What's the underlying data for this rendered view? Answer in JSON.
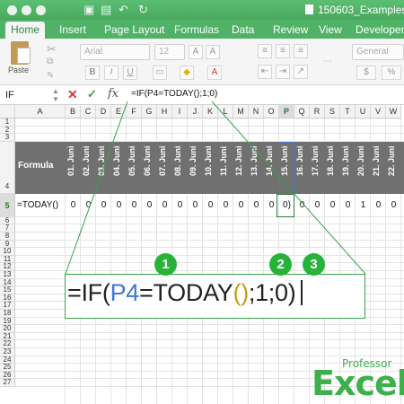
{
  "title_bar": {
    "doc_title": "150603_Examples"
  },
  "tabs": [
    {
      "label": "Home",
      "active": true
    },
    {
      "label": "Insert"
    },
    {
      "label": "Page Layout"
    },
    {
      "label": "Formulas"
    },
    {
      "label": "Data"
    },
    {
      "label": "Review"
    },
    {
      "label": "View"
    },
    {
      "label": "Developer"
    }
  ],
  "ribbon": {
    "paste_label": "Paste",
    "font_name": "Arial",
    "font_size": "12",
    "bold": "B",
    "italic": "I",
    "underline": "U",
    "number_format": "General",
    "currency": "$",
    "percent": "%"
  },
  "formula_bar": {
    "name_box": "IF",
    "cancel_icon": "✕",
    "enter_icon": "✓",
    "fx_label": "fx",
    "formula": "=IF(P4=TODAY();1;0)"
  },
  "grid": {
    "columns": [
      "A",
      "B",
      "C",
      "D",
      "E",
      "F",
      "G",
      "H",
      "I",
      "J",
      "K",
      "L",
      "M",
      "N",
      "O",
      "P",
      "Q",
      "R",
      "S",
      "T",
      "U",
      "V",
      "W"
    ],
    "selected_column": "P",
    "rows": [
      "1",
      "2",
      "3",
      "4",
      "5",
      "6",
      "7",
      "8",
      "9",
      "10",
      "11",
      "12",
      "13",
      "14",
      "15",
      "16",
      "17",
      "18",
      "19",
      "20",
      "21",
      "22",
      "23",
      "24",
      "25",
      "26",
      "27"
    ],
    "row4_label": "Formula",
    "dates": [
      "01. Juni",
      "02. Juni",
      "03. Juni",
      "04. Juni",
      "05. Juni",
      "06. Juni",
      "07. Juni",
      "08. Juni",
      "09. Juni",
      "10. Juni",
      "11. Juni",
      "12. Juni",
      "13. Juni",
      "14. Juni",
      "15. Juni",
      "16. Juni",
      "17. Juni",
      "18. Juni",
      "19. Juni",
      "20. Juni",
      "21. Juni",
      "22. Juni"
    ],
    "row5_label": "=TODAY()",
    "row5_values": [
      "0",
      "0",
      "0",
      "0",
      "0",
      "0",
      "0",
      "0",
      "0",
      "0",
      "0",
      "0",
      "0",
      "0",
      "0)",
      "0",
      "0",
      "0",
      "0",
      "1",
      "0",
      "0"
    ]
  },
  "callout": {
    "part1": "=IF(",
    "ref": "P4",
    "part2": "=TODAY",
    "parens": "()",
    "part3": ";1;0)",
    "badges": [
      "1",
      "2",
      "3"
    ]
  },
  "logo": {
    "small": "Professor",
    "big": "Excel"
  },
  "colors": {
    "accent": "#4fb266",
    "ref_blue": "#3f77d8",
    "paren_gold": "#c79e0b",
    "badge_green": "#27b33a"
  }
}
